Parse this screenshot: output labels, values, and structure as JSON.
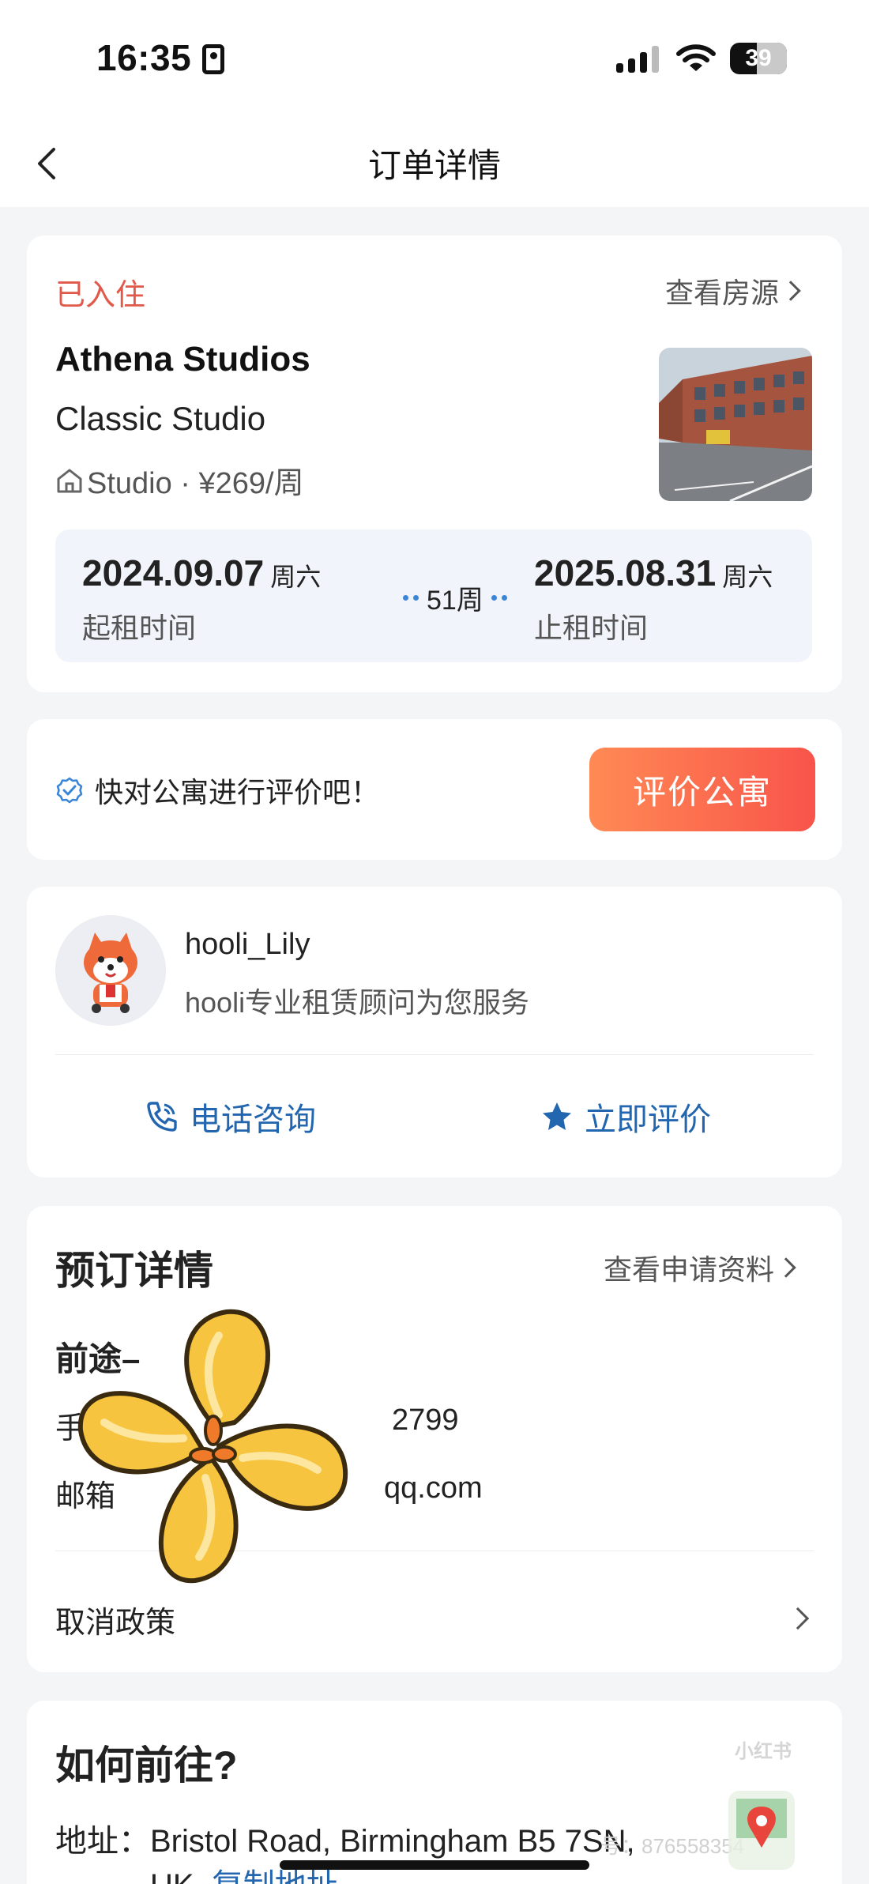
{
  "status_bar": {
    "time": "16:35",
    "battery": "39"
  },
  "nav": {
    "title": "订单详情"
  },
  "order": {
    "status": "已入住",
    "view_listing": "查看房源",
    "property_name": "Athena Studios",
    "room_type": "Classic Studio",
    "room_meta": "Studio · ¥269/周",
    "start_date": "2024.09.07",
    "start_weekday": "周六",
    "start_label": "起租时间",
    "duration": "51周",
    "end_date": "2025.08.31",
    "end_weekday": "周六",
    "end_label": "止租时间"
  },
  "review": {
    "prompt": "快对公寓进行评价吧！",
    "button": "评价公寓"
  },
  "agent": {
    "name": "hooli_Lily",
    "description": "hooli专业租赁顾问为您服务",
    "call_button": "电话咨询",
    "rate_button": "立即评价"
  },
  "booking": {
    "title": "预订详情",
    "view_application": "查看申请资料",
    "name_visible": "前途–",
    "phone_visible": "2799",
    "email_visible": "qq.com",
    "phone_prefix_visible": "手",
    "email_prefix_visible": "邮箱",
    "cancel_policy": "取消政策"
  },
  "route": {
    "title": "如何前往?",
    "address_label": "地址：",
    "address_value": "Bristol Road, Birmingham B5 7SN,",
    "address_cont": "UK",
    "copy_link": "复制地址"
  },
  "overlay": {
    "badge": "小红书",
    "id_text": "号：876558354"
  },
  "colors": {
    "status_red": "#e0594a",
    "link_blue": "#2266b0",
    "button_gradient_start": "#ff8a55",
    "button_gradient_end": "#f8544a",
    "date_box_bg": "#f1f5fb"
  },
  "icons": [
    "back-icon",
    "chevron-right-icon",
    "house-icon",
    "check-badge-icon",
    "phone-icon",
    "star-icon",
    "map-pin-icon",
    "flower-sticker"
  ]
}
